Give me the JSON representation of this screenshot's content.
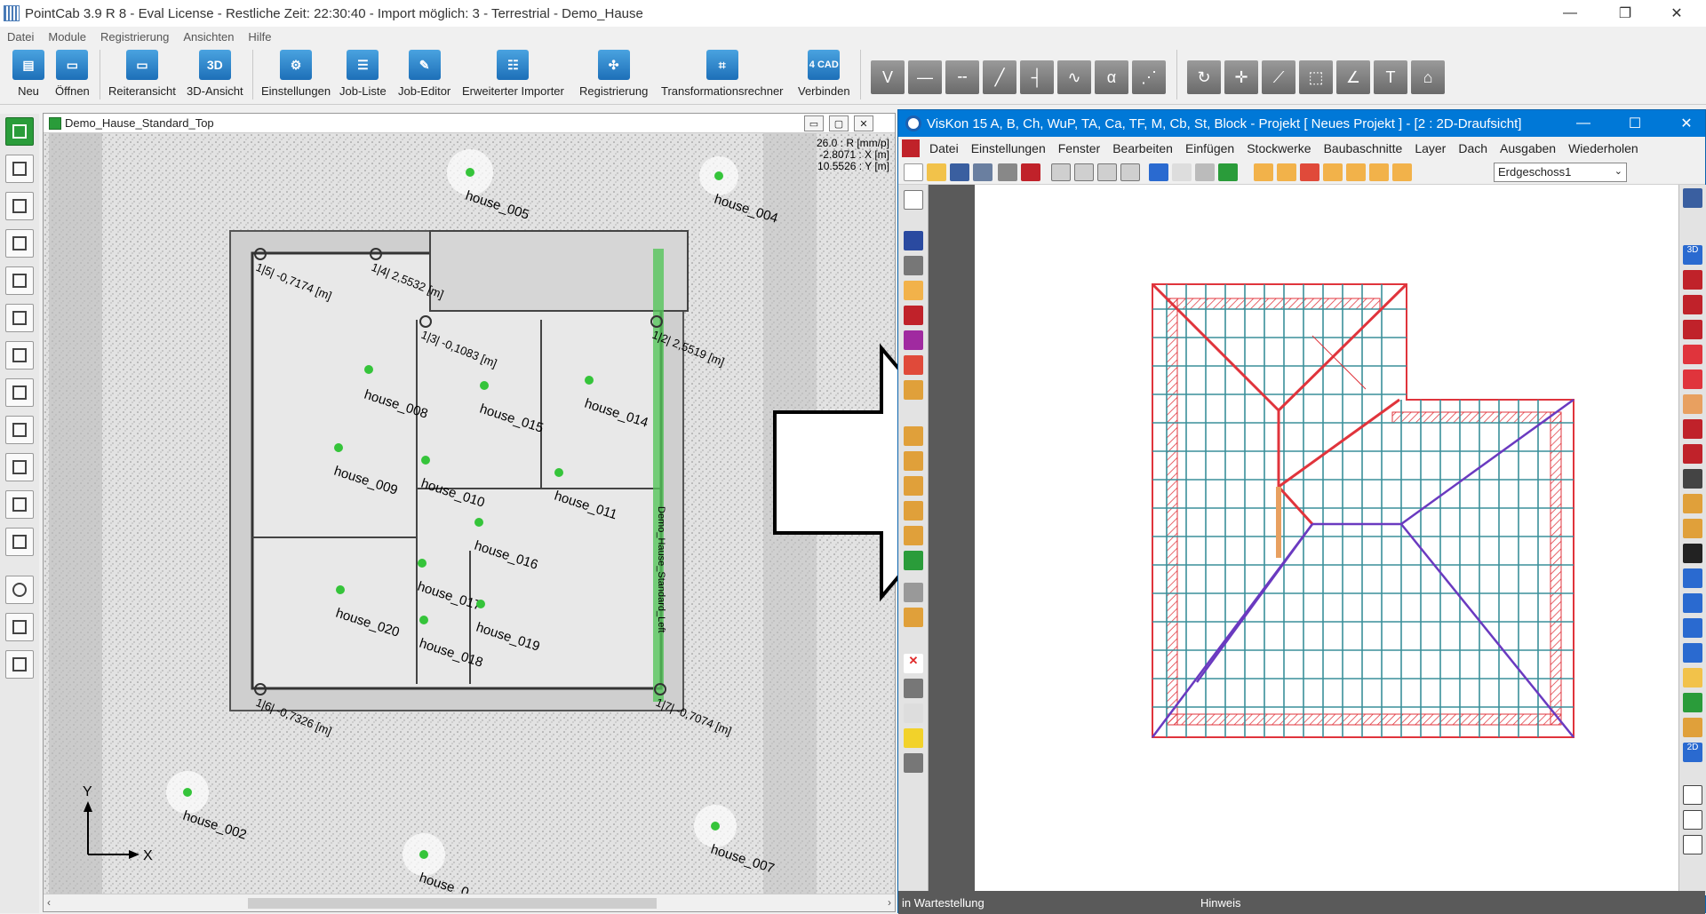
{
  "main_window": {
    "title": "PointCab 3.9 R 8 - Eval License - Restliche Zeit: 22:30:40 - Import möglich: 3 - Terrestrial - Demo_Hause",
    "controls": {
      "minimize": "—",
      "restore": "❐",
      "close": "✕"
    }
  },
  "menu": [
    "Datei",
    "Module",
    "Registrierung",
    "Ansichten",
    "Hilfe"
  ],
  "toolbar": {
    "buttons": [
      {
        "label": "Neu",
        "icon": "new-file-icon"
      },
      {
        "label": "Öffnen",
        "icon": "open-folder-icon"
      },
      {
        "label": "Reiteransicht",
        "icon": "tab-view-icon"
      },
      {
        "label": "3D-Ansicht",
        "icon": "3d-view-icon",
        "glyph": "3D"
      },
      {
        "label": "Einstellungen",
        "icon": "settings-gear-icon"
      },
      {
        "label": "Job-Liste",
        "icon": "job-list-icon"
      },
      {
        "label": "Job-Editor",
        "icon": "job-editor-icon"
      },
      {
        "label": "Erweiterter Importer",
        "icon": "importer-icon"
      },
      {
        "label": "Registrierung",
        "icon": "registration-icon"
      },
      {
        "label": "Transformationsrechner",
        "icon": "transform-calculator-icon"
      },
      {
        "label": "Verbinden",
        "icon": "connect-4cad-icon",
        "glyph": "4 CAD"
      }
    ]
  },
  "pointcab_view": {
    "title": "Demo_Hause_Standard_Top",
    "readout": [
      "26.0 : R [mm/p]",
      "-2.8071 : X [m]",
      "10.5526 : Y [m]"
    ],
    "stations": [
      {
        "label": "house_005"
      },
      {
        "label": "house_004"
      },
      {
        "label": "house_008"
      },
      {
        "label": "house_015"
      },
      {
        "label": "house_014"
      },
      {
        "label": "house_009"
      },
      {
        "label": "house_010"
      },
      {
        "label": "house_011"
      },
      {
        "label": "house_016"
      },
      {
        "label": "house_017"
      },
      {
        "label": "house_020"
      },
      {
        "label": "house_018"
      },
      {
        "label": "house_019"
      },
      {
        "label": "house_002"
      },
      {
        "label": "house_007"
      },
      {
        "label": "house_0"
      }
    ],
    "markers": [
      {
        "label": "1|5| -0,7174 [m]"
      },
      {
        "label": "1|4| 2,5532 [m]"
      },
      {
        "label": "1|3| -0,1083 [m]"
      },
      {
        "label": "1|2| 2,5519 [m]"
      },
      {
        "label": "1|6| -0,7326 [m]"
      },
      {
        "label": "1|7| -0,7074 [m]"
      }
    ],
    "section_label": "Demo_Hause_Standard_Left",
    "axes": {
      "y": "Y",
      "x": "X"
    }
  },
  "viskon": {
    "title": "VisKon 15 A, B, Ch, WuP, TA, Ca, TF, M, Cb, St, Block - Projekt [ Neues Projekt ]  - [2 : 2D-Draufsicht]",
    "menu": [
      "Datei",
      "Einstellungen",
      "Fenster",
      "Bearbeiten",
      "Einfügen",
      "Stockwerke",
      "Baubaschnitte",
      "Layer",
      "Dach",
      "Ausgaben",
      "Wiederholen"
    ],
    "floor_select": "Erdgeschoss1",
    "status": {
      "left": "in Wartestellung",
      "right": "Hinweis"
    }
  },
  "colors": {
    "accent_blue": "#0078d7",
    "station_green": "#35c43a",
    "roof_red": "#e0343c",
    "roof_teal": "#3a8f9a"
  }
}
